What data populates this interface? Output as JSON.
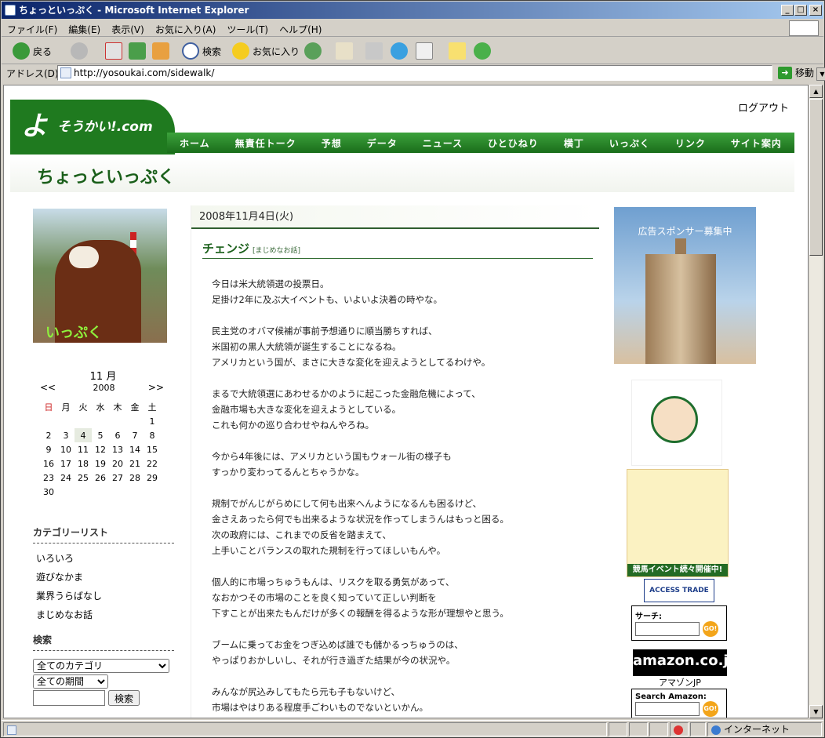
{
  "window": {
    "title": "ちょっといっぷく - Microsoft Internet Explorer"
  },
  "menu": [
    "ファイル(F)",
    "編集(E)",
    "表示(V)",
    "お気に入り(A)",
    "ツール(T)",
    "ヘルプ(H)"
  ],
  "toolbar": {
    "back": "戻る",
    "search": "検索",
    "favorites": "お気に入り"
  },
  "address": {
    "label": "アドレス(D)",
    "url": "http://yosoukai.com/sidewalk/",
    "go": "移動"
  },
  "status": {
    "zone": "インターネット"
  },
  "site": {
    "logo_main": "よ",
    "logo_rest": "そうかい!.com",
    "logout": "ログアウト",
    "nav": [
      "ホーム",
      "無責任トーク",
      "予想",
      "データ",
      "ニュース",
      "ひとひねり",
      "横丁",
      "いっぷく",
      "リンク",
      "サイト案内"
    ],
    "blog_title": "ちょっといっぷく"
  },
  "left": {
    "photo_label": "いっぷく",
    "calendar": {
      "month": "11 月",
      "year": "2008",
      "prev": "<<",
      "next": ">>",
      "weekdays": [
        "日",
        "月",
        "火",
        "水",
        "木",
        "金",
        "土"
      ],
      "weeks": [
        [
          "",
          "",
          "",
          "",
          "",
          "",
          "1"
        ],
        [
          "2",
          "3",
          "4",
          "5",
          "6",
          "7",
          "8"
        ],
        [
          "9",
          "10",
          "11",
          "12",
          "13",
          "14",
          "15"
        ],
        [
          "16",
          "17",
          "18",
          "19",
          "20",
          "21",
          "22"
        ],
        [
          "23",
          "24",
          "25",
          "26",
          "27",
          "28",
          "29"
        ],
        [
          "30",
          "",
          "",
          "",
          "",
          "",
          ""
        ]
      ],
      "today": "4"
    },
    "category_heading": "カテゴリーリスト",
    "categories": [
      "いろいろ",
      "遊びなかま",
      "業界うらばなし",
      "まじめなお話"
    ],
    "search_heading": "検索",
    "search_category": "全てのカテゴリ",
    "search_period": "全ての期間",
    "search_button": "検索"
  },
  "entry": {
    "date": "2008年11月4日(火)",
    "title": "チェンジ",
    "category": "[まじめなお話]",
    "paragraphs": [
      [
        "今日は米大統領選の投票日。",
        "足掛け2年に及ぶ大イベントも、いよいよ決着の時やな。"
      ],
      [
        "民主党のオバマ候補が事前予想通りに順当勝ちすれば、",
        "米国初の黒人大統領が誕生することになるね。",
        "アメリカという国が、まさに大きな変化を迎えようとしてるわけや。"
      ],
      [
        "まるで大統領選にあわせるかのように起こった金融危機によって、",
        "金融市場も大きな変化を迎えようとしている。",
        "これも何かの巡り合わせやねんやろね。"
      ],
      [
        "今から4年後には、アメリカという国もウォール街の様子も",
        "すっかり変わってるんとちゃうかな。"
      ],
      [
        "規制でがんじがらめにして何も出来へんようになるんも困るけど、",
        "金さえあったら何でも出来るような状況を作ってしまうんはもっと困る。",
        "次の政府には、これまでの反省を踏まえて、",
        "上手いことバランスの取れた規制を行ってほしいもんや。"
      ],
      [
        "個人的に市場っちゅうもんは、リスクを取る勇気があって、",
        "なおかつその市場のことを良く知っていて正しい判断を",
        "下すことが出来たもんだけが多くの報酬を得るような形が理想やと思う。"
      ],
      [
        "ブームに乗ってお金をつぎ込めば誰でも儲かるっちゅうのは、",
        "やっぱりおかしいし、それが行き過ぎた結果が今の状況や。"
      ],
      [
        "みんなが尻込みしてもたら元も子もないけど、",
        "市場はやはりある程度手ごわいものでないといかん。"
      ]
    ]
  },
  "right": {
    "ad1_text": "広告スポンサー募集中",
    "ad3_banner": "競馬イベント続々開催中!",
    "access_trade": "ACCESS TRADE",
    "amazon_search_label": "サーチ:",
    "amazon_go": "GO!",
    "amazon_logo": "amazon.co.jp",
    "amazon_caption": "アマゾンJP",
    "amazon_search2_label": "Search Amazon:"
  }
}
